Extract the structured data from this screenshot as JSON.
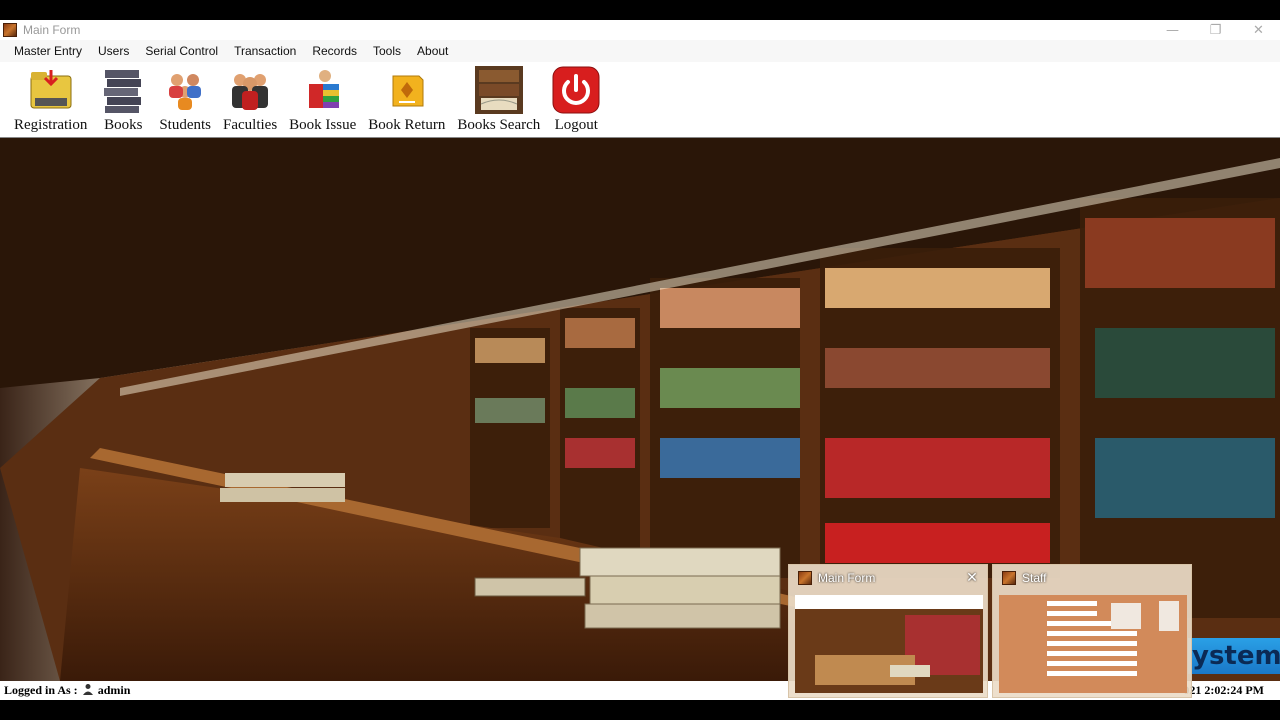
{
  "window": {
    "title": "Main Form",
    "controls": {
      "minimize": "—",
      "restore": "❐",
      "close": "✕"
    }
  },
  "menu": [
    "Master Entry",
    "Users",
    "Serial Control",
    "Transaction",
    "Records",
    "Tools",
    "About"
  ],
  "toolbar": [
    {
      "label": "Registration",
      "icon": "registration-folder-icon"
    },
    {
      "label": "Books",
      "icon": "books-stack-icon"
    },
    {
      "label": "Students",
      "icon": "students-icon"
    },
    {
      "label": "Faculties",
      "icon": "faculties-icon"
    },
    {
      "label": "Book Issue",
      "icon": "book-issue-icon"
    },
    {
      "label": "Book Return",
      "icon": "book-return-icon"
    },
    {
      "label": "Books Search",
      "icon": "books-search-icon"
    },
    {
      "label": "Logout",
      "icon": "power-icon"
    }
  ],
  "status": {
    "logged_in_label": "Logged in As :",
    "user": "admin",
    "datetime": "021 2:02:24 PM"
  },
  "taskbar_previews": [
    {
      "title": "Main Form"
    },
    {
      "title": "Staff"
    }
  ],
  "overlay": {
    "text": "ystem"
  },
  "colors": {
    "accent": "#c8742c",
    "logout_red": "#d81e1e"
  }
}
